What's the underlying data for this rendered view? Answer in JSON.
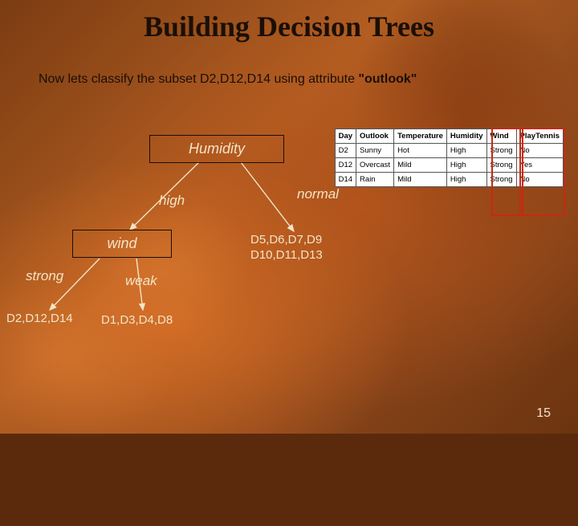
{
  "title": "Building Decision Trees",
  "subtitle_prefix": "Now  lets classify the  subset D2,D12,D14 using attribute ",
  "subtitle_attr": "\"outlook\"",
  "nodes": {
    "root": "Humidity",
    "wind": "wind"
  },
  "edges": {
    "high": "high",
    "normal": "normal",
    "strong": "strong",
    "weak": "weak"
  },
  "leaves": {
    "normal_set_line1": "D5,D6,D7,D9",
    "normal_set_line2": "D10,D11,D13",
    "strong_set": "D2,D12,D14",
    "weak_set": "D1,D3,D4,D8"
  },
  "table": {
    "headers": [
      "Day",
      "Outlook",
      "Temperature",
      "Humidity",
      "Wind",
      "PlayTennis"
    ],
    "rows": [
      [
        "D2",
        "Sunny",
        "Hot",
        "High",
        "Strong",
        "No"
      ],
      [
        "D12",
        "Overcast",
        "Mild",
        "High",
        "Strong",
        "Yes"
      ],
      [
        "D14",
        "Rain",
        "Mild",
        "High",
        "Strong",
        "No"
      ]
    ]
  },
  "page_number": "15"
}
